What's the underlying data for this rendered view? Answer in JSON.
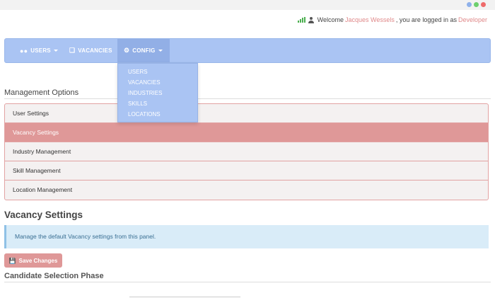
{
  "header": {
    "welcome_prefix": "Welcome",
    "user_name": "Jacques Wessels",
    "logged_in_text": ", you are logged in as",
    "role": "Developer"
  },
  "navbar": {
    "users": "USERS",
    "vacancies": "VACANCIES",
    "config": "CONFIG"
  },
  "config_menu": {
    "items": [
      "USERS",
      "VACANCIES",
      "INDUSTRIES",
      "SKILLS",
      "LOCATIONS"
    ]
  },
  "management": {
    "title": "Management Options",
    "items": [
      "User Settings",
      "Vacancy Settings",
      "Industry Management",
      "Skill Management",
      "Location Management"
    ],
    "active": "Vacancy Settings"
  },
  "vacancy_settings": {
    "title": "Vacancy Settings",
    "info": "Manage the default Vacancy settings from this panel.",
    "save_label": "Save Changes",
    "subsection": "Candidate Selection Phase"
  },
  "colors": {
    "accent": "#aac4f3",
    "highlight": "#df9898",
    "info_bg": "#d9ecf8"
  },
  "icons": {
    "users": "users-icon",
    "vacancies": "copy-icon",
    "config": "cogs-icon",
    "save": "floppy-disk-icon",
    "signal": "signal-icon",
    "user": "user-icon"
  }
}
